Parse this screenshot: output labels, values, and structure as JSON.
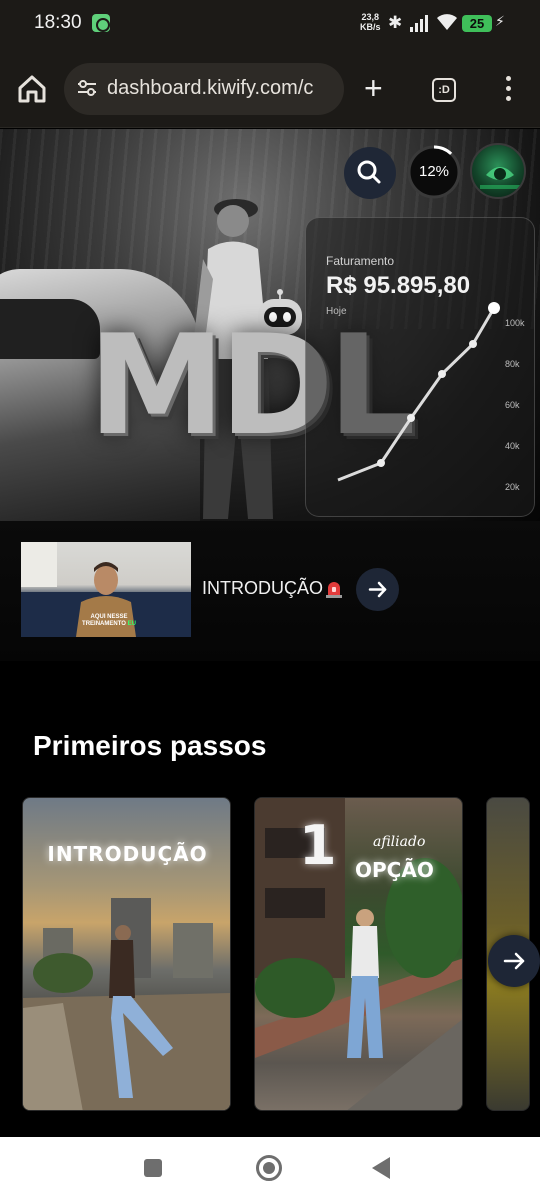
{
  "status_bar": {
    "time": "18:30",
    "net_speed_value": "23,8",
    "net_speed_unit": "KB/s",
    "battery": "25"
  },
  "browser": {
    "url": "dashboard.kiwify.com/c",
    "tabs_label": ":D"
  },
  "hero": {
    "logo_text": "MDL",
    "stats_label": "Faturamento",
    "stats_value": "R$ 95.895,80",
    "stats_period": "Hoje",
    "chart_ticks": [
      "100k",
      "80k",
      "60k",
      "40k",
      "20k"
    ],
    "progress_label": "12%",
    "progress_value": 0.12
  },
  "featured": {
    "title": "INTRODUÇÃO",
    "thumb_caption_line1": "AQUI NESSE",
    "thumb_caption_line2": "TREINAMENTO",
    "thumb_caption_highlight": "EU"
  },
  "section": {
    "title": "Primeiros passos",
    "cards": [
      {
        "title": "INTRODUÇÃO"
      },
      {
        "number": "1",
        "script": "afiliado",
        "title": "OPÇÃO"
      }
    ]
  },
  "colors": {
    "accent_button": "#1e2636",
    "battery": "#3fbf5a",
    "thumb_highlight": "#34ff6a"
  }
}
